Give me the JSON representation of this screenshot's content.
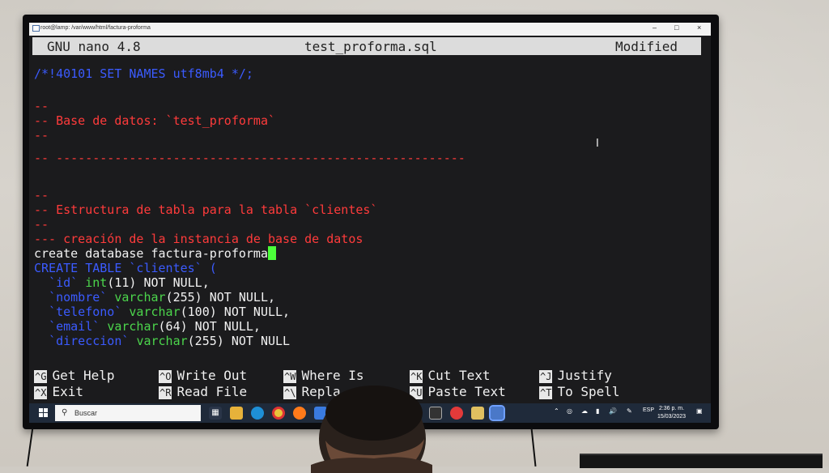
{
  "window": {
    "title": "root@lamp: /var/www/html/factura-proforma",
    "controls": [
      "–",
      "□",
      "×"
    ]
  },
  "nano": {
    "version": "GNU nano 4.8",
    "filename": "test_proforma.sql",
    "status": "Modified"
  },
  "editor_lines": [
    {
      "text": "/*!40101 SET NAMES utf8mb4 */;",
      "color": "blue"
    },
    {
      "text": "--",
      "color": "red"
    },
    {
      "text": "-- Base de datos: `test_proforma`",
      "color": "red"
    },
    {
      "text": "--",
      "color": "red"
    },
    {
      "text": "-- --------------------------------------------------------",
      "color": "red"
    },
    {
      "text": "--",
      "color": "red"
    },
    {
      "text": "-- Estructura de tabla para la tabla `clientes`",
      "color": "red"
    },
    {
      "text": "--",
      "color": "red"
    },
    {
      "text": "--- creación de la instancia de base de datos",
      "color": "red"
    },
    {
      "text": "create database factura-proforma",
      "color": "white"
    },
    {
      "text": "CREATE TABLE `clientes` (",
      "color": "blue"
    },
    {
      "text": "  `id` int(11) NOT NULL,",
      "color": "mixed"
    },
    {
      "text": "  `nombre` varchar(255) NOT NULL,",
      "color": "mixed"
    },
    {
      "text": "  `telefono` varchar(100) NOT NULL,",
      "color": "mixed"
    },
    {
      "text": "  `email` varchar(64) NOT NULL,",
      "color": "mixed"
    },
    {
      "text": "  `direccion` varchar(255) NOT NULL",
      "color": "mixed"
    }
  ],
  "columns": [
    {
      "name": "`id`",
      "type": "int",
      "args": "(11) NOT NULL,"
    },
    {
      "name": "`nombre`",
      "type": "varchar",
      "args": "(255) NOT NULL,"
    },
    {
      "name": "`telefono`",
      "type": "varchar",
      "args": "(100) NOT NULL,"
    },
    {
      "name": "`email`",
      "type": "varchar",
      "args": "(64) NOT NULL,"
    },
    {
      "name": "`direccion`",
      "type": "varchar",
      "args": "(255) NOT NULL"
    }
  ],
  "shortcuts": [
    {
      "key": "^G",
      "label": "Get Help"
    },
    {
      "key": "^O",
      "label": "Write Out"
    },
    {
      "key": "^W",
      "label": "Where Is"
    },
    {
      "key": "^K",
      "label": "Cut Text"
    },
    {
      "key": "^J",
      "label": "Justify"
    },
    {
      "key": "^X",
      "label": "Exit"
    },
    {
      "key": "^R",
      "label": "Read File"
    },
    {
      "key": "^\\",
      "label": "Repla"
    },
    {
      "key": "^U",
      "label": "Paste Text"
    },
    {
      "key": "^T",
      "label": "To Spell"
    }
  ],
  "taskbar": {
    "search_placeholder": "Buscar",
    "language": "ESP",
    "time": "2:36 p. m.",
    "date": "15/03/2023"
  },
  "colors": {
    "comment": "#ff3b3b",
    "keyword": "#3b5bff",
    "type": "#4cd64c",
    "cursor": "#4cff3a"
  }
}
